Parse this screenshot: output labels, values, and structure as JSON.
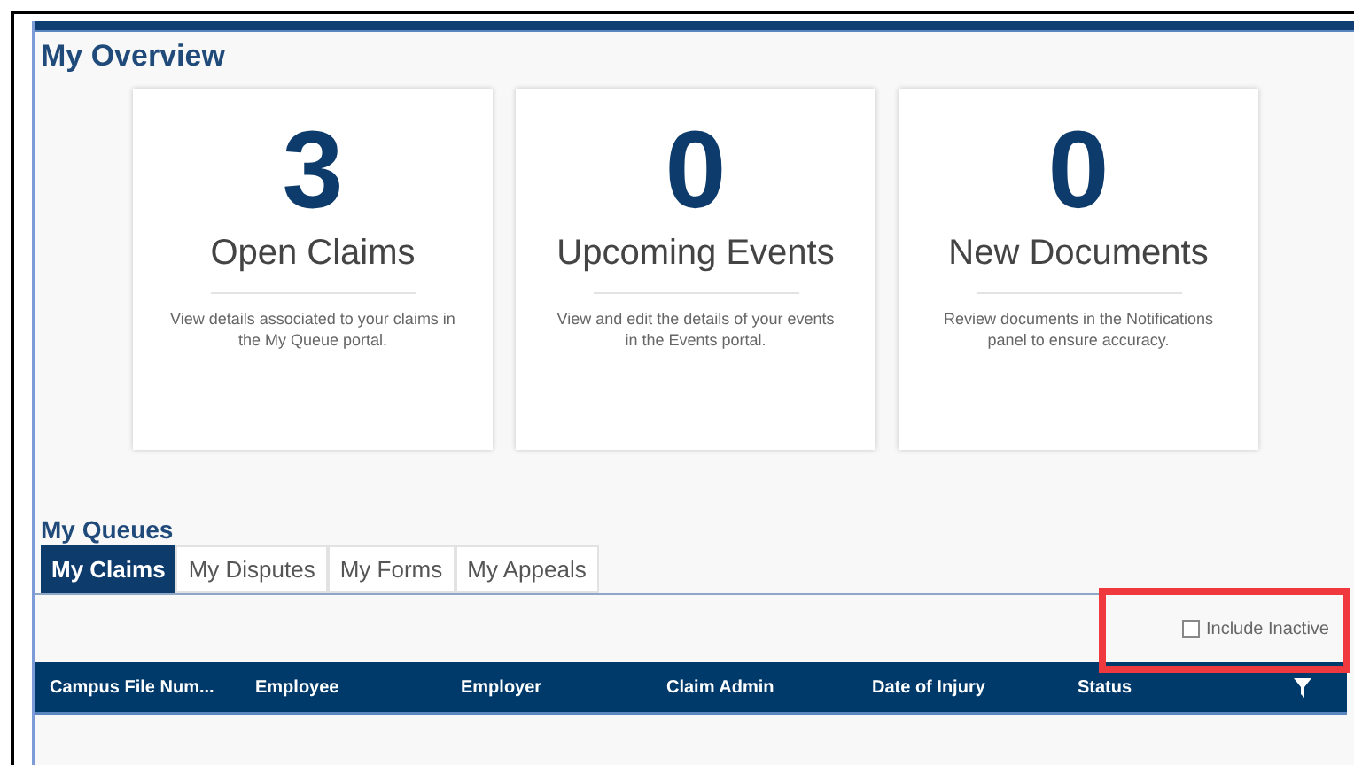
{
  "overview": {
    "title": "My Overview",
    "cards": [
      {
        "count": "3",
        "label": "Open Claims",
        "description": "View details associated to your claims in the My Queue portal."
      },
      {
        "count": "0",
        "label": "Upcoming Events",
        "description": "View and edit the details of your events in the Events portal."
      },
      {
        "count": "0",
        "label": "New Documents",
        "description": "Review documents in the Notifications panel to ensure accuracy."
      }
    ]
  },
  "queues": {
    "title": "My Queues",
    "tabs": [
      {
        "label": "My Claims",
        "selected": true
      },
      {
        "label": "My Disputes",
        "selected": false
      },
      {
        "label": "My Forms",
        "selected": false
      },
      {
        "label": "My Appeals",
        "selected": false
      }
    ],
    "include_inactive": {
      "label": "Include Inactive",
      "checked": false
    },
    "table": {
      "columns": [
        "Campus File Num...",
        "Employee",
        "Employer",
        "Claim Admin",
        "Date of Injury",
        "Status"
      ]
    }
  }
}
